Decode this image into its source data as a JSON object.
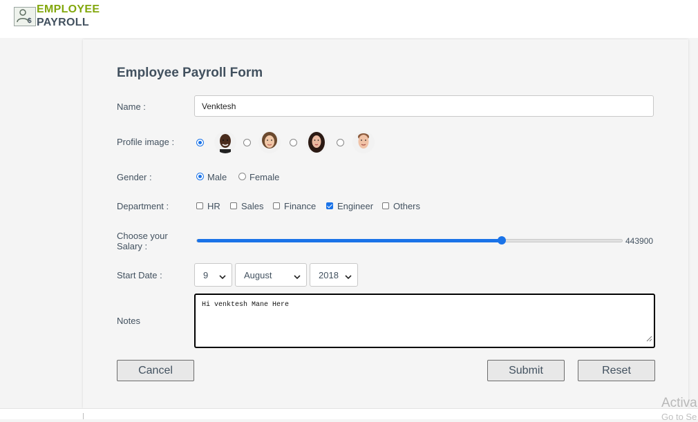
{
  "header": {
    "brand_line1": "EMPLOYEE",
    "brand_line2": "PAYROLL",
    "logo_icon": "user-dollar-icon"
  },
  "form": {
    "title": "Employee Payroll Form",
    "name_label": "Name :",
    "name_value": "Venktesh",
    "profile_label": "Profile image :",
    "profile_images": [
      {
        "icon": "avatar-man-dark-skin",
        "selected": true
      },
      {
        "icon": "avatar-woman-light",
        "selected": false
      },
      {
        "icon": "avatar-woman-dark-hair",
        "selected": false
      },
      {
        "icon": "avatar-man-light",
        "selected": false
      }
    ],
    "gender_label": "Gender :",
    "gender_options": [
      {
        "label": "Male",
        "selected": true
      },
      {
        "label": "Female",
        "selected": false
      }
    ],
    "department_label": "Department :",
    "departments": [
      {
        "label": "HR",
        "checked": false
      },
      {
        "label": "Sales",
        "checked": false
      },
      {
        "label": "Finance",
        "checked": false
      },
      {
        "label": "Engineer",
        "checked": true
      },
      {
        "label": "Others",
        "checked": false
      }
    ],
    "salary_label_line1": "Choose your",
    "salary_label_line2": "Salary :",
    "salary_value": "443900",
    "salary_fraction": 0.7146,
    "start_date_label": "Start Date :",
    "start_day": "9",
    "start_month": "August",
    "start_year": "2018",
    "notes_label": "Notes",
    "notes_value": "Hi venktesh Mane Here"
  },
  "buttons": {
    "cancel": "Cancel",
    "submit": "Submit",
    "reset": "Reset"
  },
  "overlay": {
    "watermark_line1": "Activa",
    "watermark_line2": "Go to Se"
  },
  "colors": {
    "accent": "#1a73e8",
    "brand_green": "#82a70c",
    "text": "#42515f"
  }
}
